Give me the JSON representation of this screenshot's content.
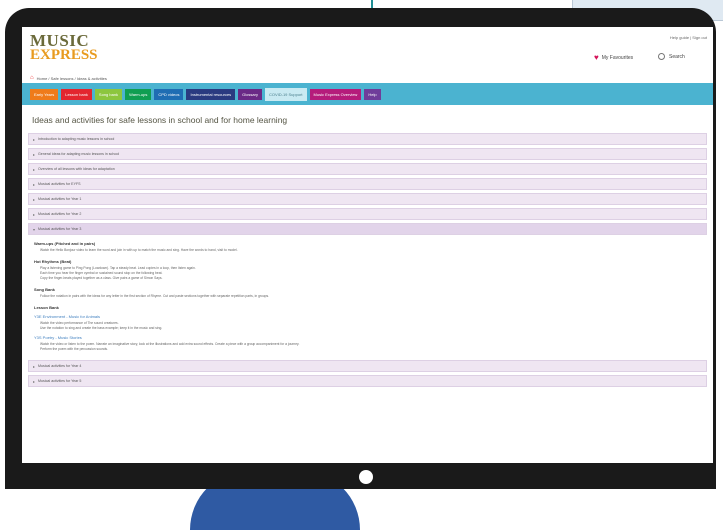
{
  "brand": {
    "line1": "MUSIC",
    "line2": "EXPRESS"
  },
  "header": {
    "top_links": "Help guide  |  Sign out",
    "favourites": "My Favourites",
    "search": "Search"
  },
  "breadcrumb": "Home  /  Safe lessons  /  Ideas & activities",
  "nav": {
    "tabs": [
      {
        "label": "Early Years",
        "color": "#ef7b1a"
      },
      {
        "label": "Lesson bank",
        "color": "#e3262f"
      },
      {
        "label": "Song bank",
        "color": "#8cc63e"
      },
      {
        "label": "Warm-ups",
        "color": "#0f9e52"
      },
      {
        "label": "CPD videos",
        "color": "#1f6db3"
      },
      {
        "label": "Instrumental resources",
        "color": "#2a3a80"
      },
      {
        "label": "Glossary",
        "color": "#6a2a86"
      },
      {
        "label": "COVID-19 Support",
        "color": "#c9eaf2"
      },
      {
        "label": "Music Express Overview",
        "color": "#b51c7b"
      },
      {
        "label": "Help",
        "color": "#6f3c9a"
      }
    ]
  },
  "page_title": "Ideas and activities for safe lessons in school and for home learning",
  "accordion": [
    "Introduction to adapting music lessons in school",
    "General ideas for adapting music lessons in school",
    "Overview of all lessons with ideas for adaptation",
    "Musical activities for EYFS",
    "Musical activities for Year 1",
    "Musical activities for Year 2",
    "Musical activities for Year 3"
  ],
  "expanded": {
    "sections": [
      {
        "heading": "Warm-ups (Pitched and in pairs)",
        "lines": [
          "Watch the Hello Bonjour video to learn the word and join in with up to match the music and sing. Have the words to hand, visit to model."
        ]
      },
      {
        "heading": "Hot Rhythms (Beat)",
        "lines": [
          "Play a listening game to Ping Pong (Lowdown). Tap a steady beat. Lead copies in a loop, then listen again.",
          "Each time you hear the finger cymbal or sustained sound stop on the following beat.",
          "Copy the finger-beats played together as a class. Give pairs a game of Simon Says."
        ]
      },
      {
        "heading": "Song Bank",
        "lines": [
          "Follow the notation in pairs with the ideas for any letter in the first section of Rhyme. Cut and paste sections together with separate repetition parts, in groups."
        ]
      },
      {
        "heading": "Lesson Bank",
        "lines": []
      }
    ],
    "links": [
      {
        "title": "Y3E Environment - Music for Animals",
        "lines": [
          "Watch the video performance of The sound creatures.",
          "Use the notation to sing and create the bass example; keep it in the music and sing."
        ]
      },
      {
        "title": "Y3S Poetry - Music Stories",
        "lines": [
          "Watch the video or listen to the poem. Narrate an imaginative story, look at the illustrations and add extra sound effects. Create a piece with a group accompaniment for a journey.",
          "Perform the poem with the percussion sounds."
        ]
      }
    ]
  },
  "accordion_after": [
    "Musical activities for Year 4",
    "Musical activities for Year 5"
  ]
}
